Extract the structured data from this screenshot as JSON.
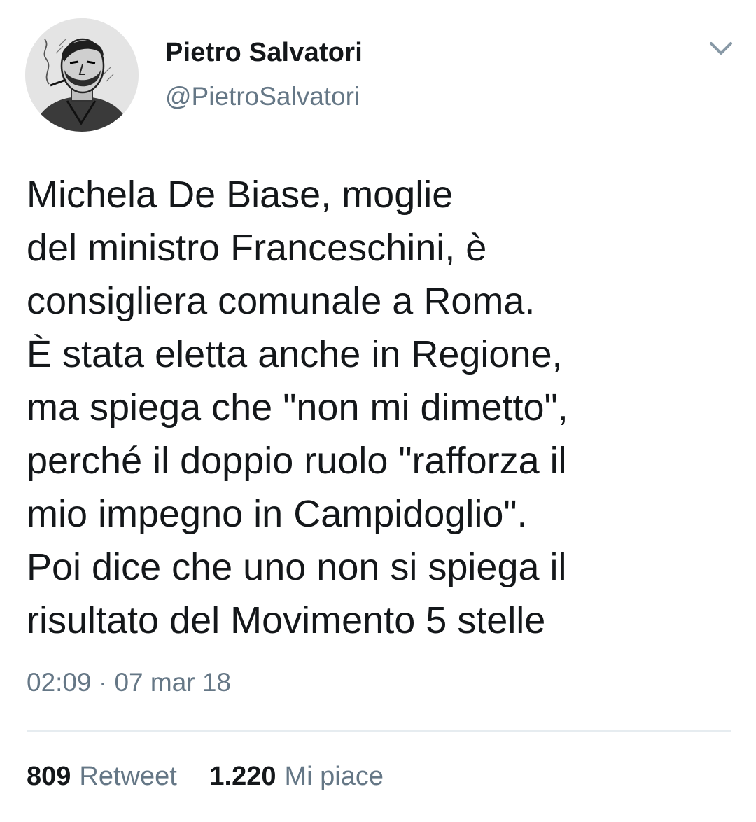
{
  "user": {
    "display_name": "Pietro Salvatori",
    "handle": "@PietroSalvatori",
    "avatar_icon": "sketch-portrait-avatar"
  },
  "tweet": {
    "text": "Michela De Biase, moglie\ndel ministro Franceschini, è\nconsigliera comunale a Roma.\nÈ stata eletta anche in Regione,\nma spiega che \"non mi dimetto\",\nperché il doppio ruolo \"rafforza il\nmio impegno in Campidoglio\".\nPoi dice che uno non si spiega il\nrisultato del Movimento 5 stelle",
    "timestamp": "02:09 · 07 mar 18"
  },
  "stats": {
    "retweets_count": "809",
    "retweets_label": "Retweet",
    "likes_count": "1.220",
    "likes_label": "Mi piace"
  },
  "menu_icon": "chevron-down-icon",
  "colors": {
    "text_primary": "#14171a",
    "text_secondary": "#657786",
    "divider": "#e6ecf0",
    "background": "#ffffff"
  }
}
